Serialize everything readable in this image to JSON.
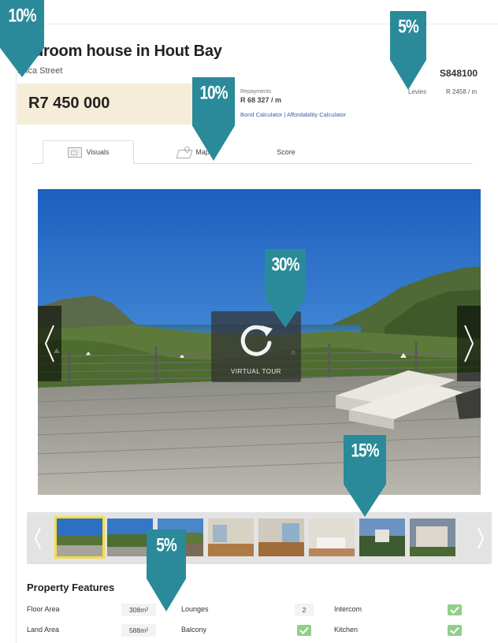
{
  "listing": {
    "title": "bedroom house in Hout Bay",
    "address": "Erica Street",
    "reference": "S848100",
    "price": "R7 450 000",
    "repayments_label": "Repayments",
    "repayments_value": "R 68 327 / m",
    "bond_calculator": "Bond Calculator",
    "link_separator": "|",
    "affordability_calculator": "Affordability Calculator",
    "levies_label": "Levies",
    "levies_value": "R 2458 / m"
  },
  "tabs": [
    {
      "label": "Visuals",
      "icon": "photo-icon",
      "active": true
    },
    {
      "label": "Map",
      "icon": "map-icon",
      "active": false
    },
    {
      "label": "Score",
      "icon": "",
      "active": false
    }
  ],
  "gallery": {
    "virtual_tour_label": "VIRTUAL TOUR",
    "thumbnail_count": 8,
    "selected_thumbnail": 1
  },
  "features": {
    "heading": "Property Features",
    "rows": [
      {
        "label": "Floor Area",
        "value": "308m²",
        "label2": "Lounges",
        "value2": "2",
        "label3": "Intercom",
        "check3": true
      },
      {
        "label": "Land Area",
        "value": "588m²",
        "label2": "Balcony",
        "check2": true,
        "label3": "Kitchen",
        "check3": true
      }
    ]
  },
  "annotations": [
    {
      "label": "10%",
      "color": "#2a8a9a"
    },
    {
      "label": "5%",
      "color": "#2a8a9a"
    },
    {
      "label": "10%",
      "color": "#2a8a9a"
    },
    {
      "label": "30%",
      "color": "#2a8a9a"
    },
    {
      "label": "15%",
      "color": "#2a8a9a"
    },
    {
      "label": "5%",
      "color": "#2a8a9a"
    }
  ],
  "colors": {
    "price_background": "#f6edd8",
    "link": "#3b5fa8",
    "marker": "#2a8a9a",
    "check": "#8fcf8a",
    "selected_thumbnail": "#f1dd4a"
  }
}
